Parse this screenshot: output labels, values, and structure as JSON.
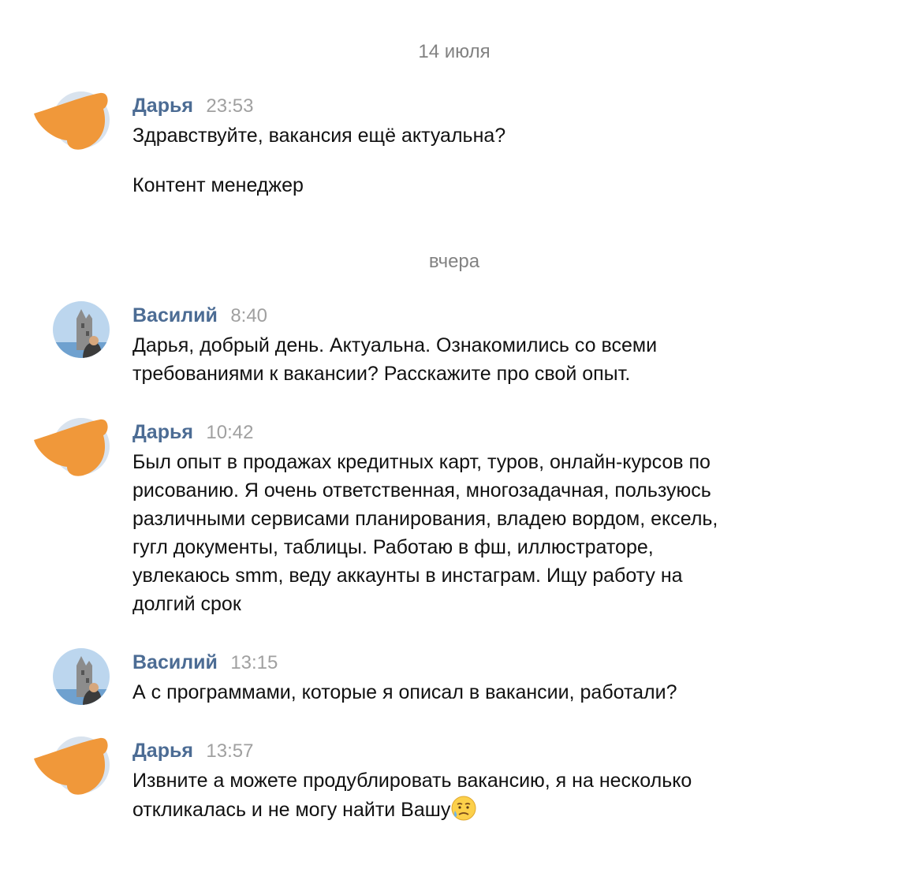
{
  "colors": {
    "name": "#4c6c94",
    "time": "#a0a0a0",
    "date_separator": "#828282",
    "redaction": "#f0983a"
  },
  "date_separators": [
    "14 июля",
    "вчера"
  ],
  "messages": [
    {
      "author": "Дарья",
      "time": "23:53",
      "avatar": "redacted-avatar",
      "lines": [
        "Здравствуйте, вакансия ещё актуальна?"
      ],
      "extra": "Контент менеджер"
    },
    {
      "author": "Василий",
      "time": "8:40",
      "avatar": "photo-avatar",
      "lines": [
        "Дарья, добрый день. Актуальна. Ознакомились со всеми",
        "требованиями к вакансии? Расскажите про свой опыт."
      ]
    },
    {
      "author": "Дарья",
      "time": "10:42",
      "avatar": "redacted-avatar",
      "lines": [
        "Был опыт в продажах кредитных карт, туров, онлайн-курсов по",
        "рисованию. Я очень ответственная, многозадачная, пользуюсь",
        "различными сервисами планирования, владею вордом, ексель,",
        "гугл документы, таблицы. Работаю в фш, иллюстраторе,",
        "увлекаюсь smm, веду аккаунты в инстаграм. Ищу работу на",
        "долгий срок"
      ]
    },
    {
      "author": "Василий",
      "time": "13:15",
      "avatar": "photo-avatar",
      "lines": [
        "А с программами, которые я описал в вакансии, работали?"
      ]
    },
    {
      "author": "Дарья",
      "time": "13:57",
      "avatar": "redacted-avatar",
      "lines": [
        "Извните а можете продублировать вакансию, я на несколько",
        "откликалась и не могу найти Вашу"
      ],
      "emoji": "sad-sweat-emoji"
    }
  ]
}
